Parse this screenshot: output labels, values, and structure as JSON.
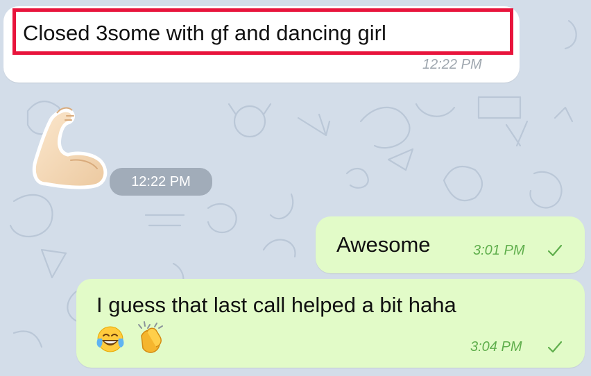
{
  "messages": [
    {
      "id": "m1",
      "direction": "incoming",
      "text": "Closed 3some with gf and dancing girl",
      "time": "12:22 PM",
      "highlighted": true
    },
    {
      "id": "m2",
      "direction": "incoming",
      "type": "sticker",
      "sticker_icon": "flexed-biceps-icon",
      "time": "12:22 PM"
    },
    {
      "id": "m3",
      "direction": "outgoing",
      "text": "Awesome",
      "time": "3:01 PM",
      "status_icon": "single-check-icon"
    },
    {
      "id": "m4",
      "direction": "outgoing",
      "text": "I guess that last call helped a bit haha",
      "emojis": [
        "face-with-tears-of-joy-icon",
        "clapping-hands-icon"
      ],
      "time": "3:04 PM",
      "status_icon": "single-check-icon"
    }
  ],
  "colors": {
    "wallpaper": "#d3dde9",
    "incoming_bubble": "#ffffff",
    "outgoing_bubble": "#e2fbc8",
    "outgoing_time": "#5fae4c",
    "incoming_time": "#9ea6ae",
    "highlight": "#e8143c"
  }
}
